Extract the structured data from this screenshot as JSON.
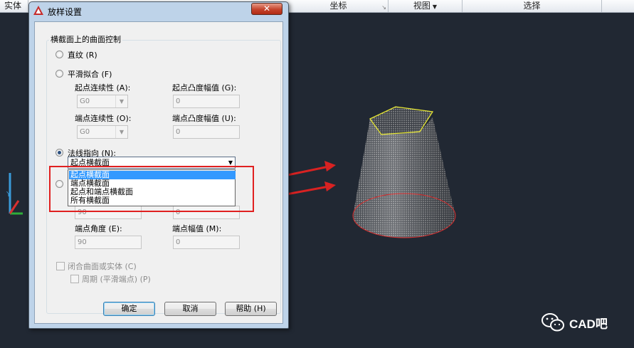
{
  "ribbon": {
    "items": [
      {
        "label": "实体"
      },
      {
        "label": "坐标"
      },
      {
        "label": "视图"
      },
      {
        "label": "选择"
      }
    ]
  },
  "dialog": {
    "title": "放样设置",
    "close_label": "✕",
    "group_title": "横截面上的曲面控制",
    "ruled": "直纹 (R)",
    "smooth_fit": "平滑拟合 (F)",
    "start_continuity_label": "起点连续性 (A):",
    "start_continuity_value": "G0",
    "start_bulge_label": "起点凸度幅值 (G):",
    "start_bulge_value": "0",
    "end_continuity_label": "端点连续性 (O):",
    "end_continuity_value": "G0",
    "end_bulge_label": "端点凸度幅值 (U):",
    "end_bulge_value": "0",
    "normal_to": "法线指向 (N):",
    "normal_to_value": "起点横截面",
    "normal_options": [
      "起点横截面",
      "端点横截面",
      "起点和端点横截面",
      "所有横截面"
    ],
    "start_angle_value": "90",
    "start_magnitude_value": "0",
    "end_angle_label": "端点角度 (E):",
    "end_angle_value": "90",
    "end_magnitude_label": "端点幅值 (M):",
    "end_magnitude_value": "0",
    "close_surface": "闭合曲面或实体 (C)",
    "periodic": "周期 (平滑端点) (P)",
    "ok": "确定",
    "cancel": "取消",
    "help": "帮助 (H)"
  },
  "ucs": {
    "x": "X",
    "y": "Y",
    "z": "Z"
  },
  "watermark": {
    "text": "CAD吧"
  },
  "colors": {
    "viewport_bg": "#212833",
    "dialog_frame": "#bed3e9",
    "highlight": "#e02020",
    "selection": "#3399ff",
    "top_profile": "#e6e632",
    "bottom_profile": "#dc2d2d"
  }
}
